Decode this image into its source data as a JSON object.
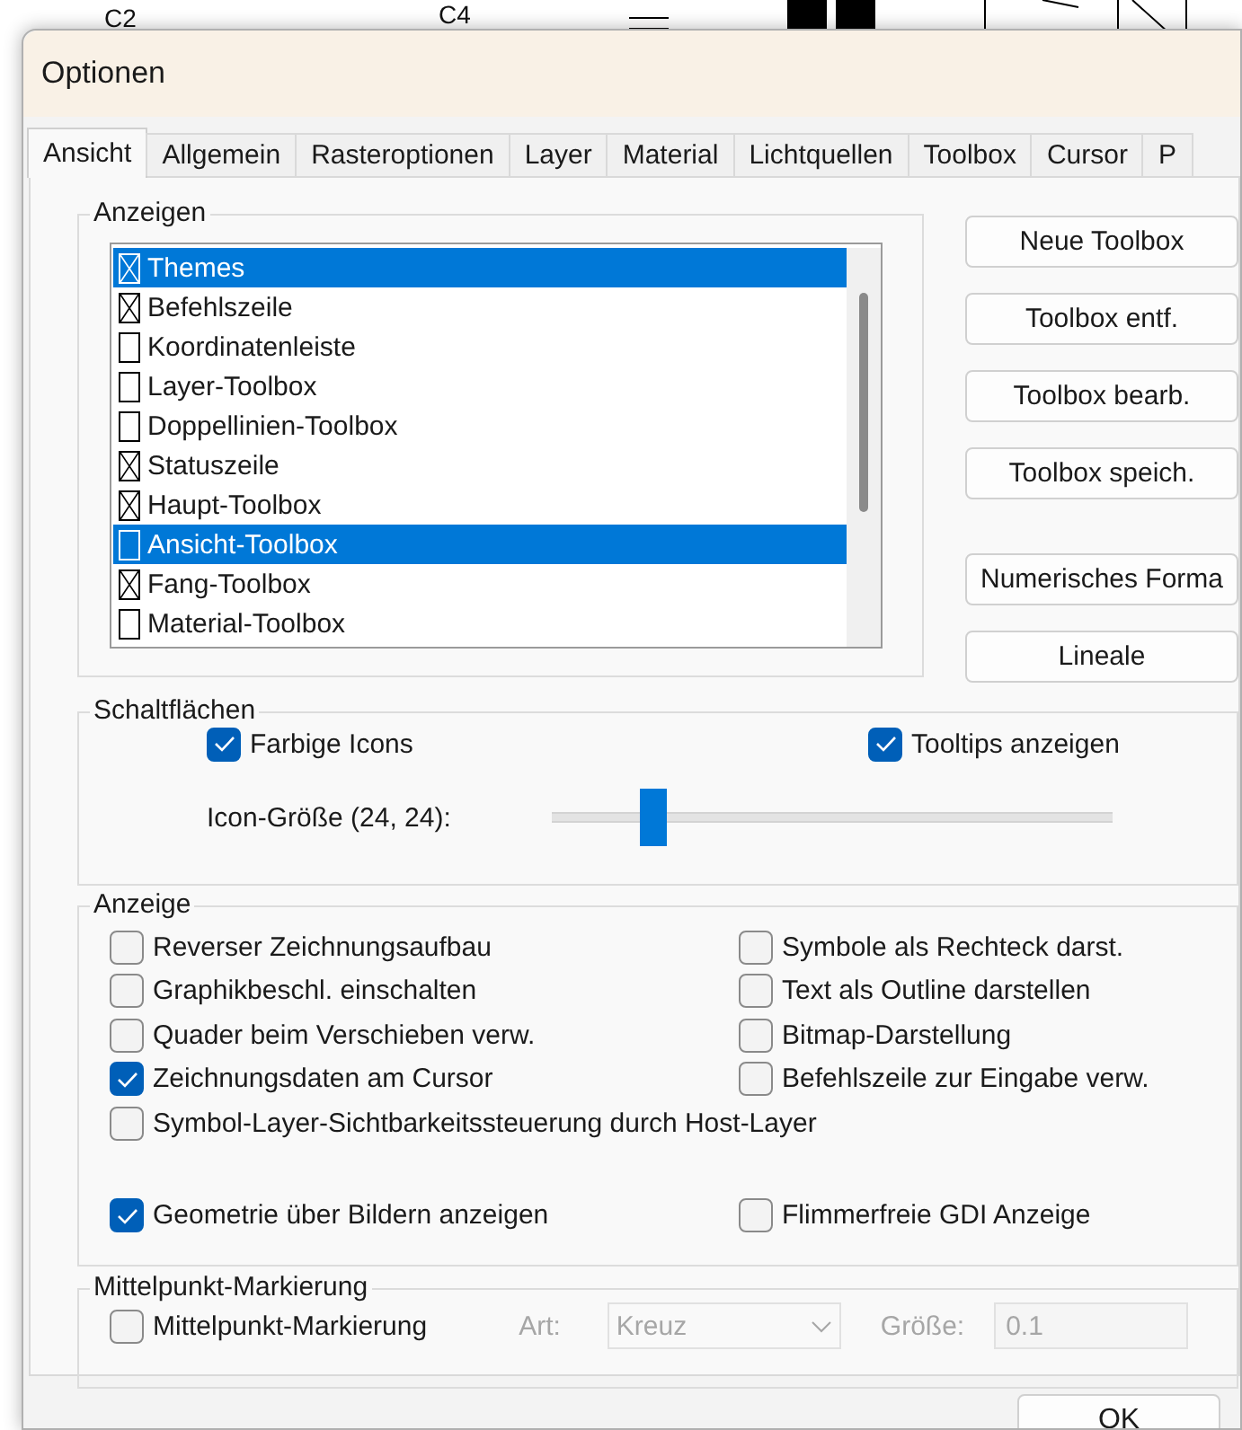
{
  "background": {
    "labels": [
      "C2",
      "C4"
    ]
  },
  "window": {
    "title": "Optionen"
  },
  "tabs": [
    {
      "label": "Ansicht",
      "selected": true
    },
    {
      "label": "Allgemein",
      "selected": false
    },
    {
      "label": "Rasteroptionen",
      "selected": false
    },
    {
      "label": "Layer",
      "selected": false
    },
    {
      "label": "Material",
      "selected": false
    },
    {
      "label": "Lichtquellen",
      "selected": false
    },
    {
      "label": "Toolbox",
      "selected": false
    },
    {
      "label": "Cursor",
      "selected": false
    },
    {
      "label": "P",
      "selected": false
    }
  ],
  "anzeigen": {
    "title": "Anzeigen",
    "items": [
      {
        "label": "Themes",
        "checked": true,
        "selected": true
      },
      {
        "label": "Befehlszeile",
        "checked": true,
        "selected": false
      },
      {
        "label": "Koordinatenleiste",
        "checked": false,
        "selected": false
      },
      {
        "label": "Layer-Toolbox",
        "checked": false,
        "selected": false
      },
      {
        "label": "Doppellinien-Toolbox",
        "checked": false,
        "selected": false
      },
      {
        "label": "Statuszeile",
        "checked": true,
        "selected": false
      },
      {
        "label": "Haupt-Toolbox",
        "checked": true,
        "selected": false
      },
      {
        "label": "Ansicht-Toolbox",
        "checked": false,
        "selected": true
      },
      {
        "label": "Fang-Toolbox",
        "checked": true,
        "selected": false
      },
      {
        "label": "Material-Toolbox",
        "checked": false,
        "selected": false
      }
    ]
  },
  "side_buttons": [
    {
      "label": "Neue Toolbox",
      "kind": "normal"
    },
    {
      "label": "Toolbox entf.",
      "kind": "normal"
    },
    {
      "label": "Toolbox bearb.",
      "kind": "normal"
    },
    {
      "label": "Toolbox speich.",
      "kind": "normal"
    },
    {
      "label": "Numerisches Forma",
      "kind": "spaced"
    },
    {
      "label": "Lineale",
      "kind": "normal"
    }
  ],
  "schaltflaechen": {
    "title": "Schaltflächen",
    "options": [
      {
        "label": "Farbige Icons",
        "checked": true
      },
      {
        "label": "Tooltips anzeigen",
        "checked": true
      }
    ],
    "icon_size": {
      "label": "Icon-Größe (24, 24):",
      "level": 0.18
    }
  },
  "anzeige": {
    "title": "Anzeige",
    "options": [
      {
        "label": "Reverser Zeichnungsaufbau",
        "checked": false,
        "kind": "normal"
      },
      {
        "label": "Symbole als Rechteck darst.",
        "checked": false,
        "kind": "normal"
      },
      {
        "label": "Graphikbeschl. einschalten",
        "checked": false,
        "kind": "normal"
      },
      {
        "label": "Text als Outline darstellen",
        "checked": false,
        "kind": "normal"
      },
      {
        "label": "Quader beim Verschieben verw.",
        "checked": false,
        "kind": "normal"
      },
      {
        "label": "Bitmap-Darstellung",
        "checked": false,
        "kind": "normal"
      },
      {
        "label": "Zeichnungsdaten am Cursor",
        "checked": true,
        "kind": "normal"
      },
      {
        "label": "Befehlszeile zur Eingabe verw.",
        "checked": false,
        "kind": "normal"
      },
      {
        "label": "Symbol-Layer-Sichtbarkeitssteuerung durch Host-Layer",
        "checked": false,
        "kind": "wide"
      },
      {
        "label": "Geometrie über Bildern anzeigen",
        "checked": true,
        "kind": "normal"
      },
      {
        "label": "Flimmerfreie GDI Anzeige",
        "checked": false,
        "kind": "normal"
      }
    ]
  },
  "mittelpunkt": {
    "title": "Mittelpunkt-Markierung",
    "checkbox": {
      "label": "Mittelpunkt-Markierung",
      "checked": false
    },
    "art": {
      "label": "Art:",
      "value": "Kreuz",
      "disabled": true
    },
    "groesse": {
      "label": "Größe:",
      "value": "0.1",
      "disabled": true
    }
  },
  "buttons": [
    "OK"
  ]
}
